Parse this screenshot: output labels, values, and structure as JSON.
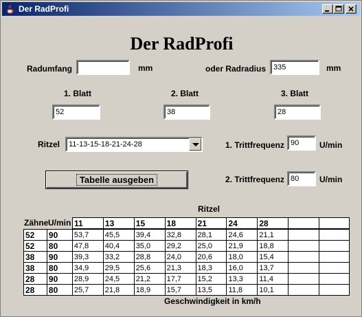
{
  "window": {
    "title": "Der RadProfi"
  },
  "heading": "Der RadProfi",
  "radumfang": {
    "label": "Radumfang",
    "value": "",
    "unit": "mm"
  },
  "radradius": {
    "label": "oder Radradius",
    "value": "335",
    "unit": "mm"
  },
  "blatt": [
    {
      "label": "1. Blatt",
      "value": "52"
    },
    {
      "label": "2. Blatt",
      "value": "38"
    },
    {
      "label": "3. Blatt",
      "value": "28"
    }
  ],
  "ritzel": {
    "label": "Ritzel",
    "selected": "11-13-15-18-21-24-28"
  },
  "trittfrequenz1": {
    "label": "1. Trittfrequenz",
    "value": "90",
    "unit": "U/min"
  },
  "trittfrequenz2": {
    "label": "2. Trittfrequenz",
    "value": "80",
    "unit": "U/min"
  },
  "button": {
    "label": "Tabelle ausgeben"
  },
  "table": {
    "caption_top": "Ritzel",
    "col_zaehne": "Zähne",
    "col_umin": "U/min",
    "ritzel": [
      "11",
      "13",
      "15",
      "18",
      "21",
      "24",
      "28",
      "",
      ""
    ],
    "rows": [
      {
        "z": "52",
        "u": "90",
        "v": [
          "53,7",
          "45,5",
          "39,4",
          "32,8",
          "28,1",
          "24,6",
          "21,1",
          "",
          ""
        ]
      },
      {
        "z": "52",
        "u": "80",
        "v": [
          "47,8",
          "40,4",
          "35,0",
          "29,2",
          "25,0",
          "21,9",
          "18,8",
          "",
          ""
        ]
      },
      {
        "z": "38",
        "u": "90",
        "v": [
          "39,3",
          "33,2",
          "28,8",
          "24,0",
          "20,6",
          "18,0",
          "15,4",
          "",
          ""
        ]
      },
      {
        "z": "38",
        "u": "80",
        "v": [
          "34,9",
          "29,5",
          "25,6",
          "21,3",
          "18,3",
          "16,0",
          "13,7",
          "",
          ""
        ]
      },
      {
        "z": "28",
        "u": "90",
        "v": [
          "28,9",
          "24,5",
          "21,2",
          "17,7",
          "15,2",
          "13,3",
          "11,4",
          "",
          ""
        ]
      },
      {
        "z": "28",
        "u": "80",
        "v": [
          "25,7",
          "21,8",
          "18,9",
          "15,7",
          "13,5",
          "11,8",
          "10,1",
          "",
          ""
        ]
      }
    ],
    "caption_bottom": "Geschwindigkeit in km/h"
  }
}
